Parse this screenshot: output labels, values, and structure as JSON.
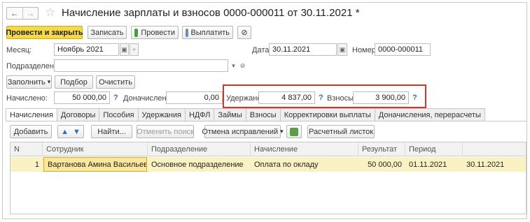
{
  "window": {
    "title": "Начисление зарплаты и взносов 0000-000011 от 30.11.2021 *",
    "nav_back": "←",
    "nav_forward": "→",
    "star_icon": "☆"
  },
  "toolbar": {
    "post_close": "Провести и закрыть",
    "save": "Записать",
    "post": "Провести",
    "pay": "Выплатить",
    "attach_icon": "⊘"
  },
  "header": {
    "month_label": "Месяц:",
    "month_value": "Ноябрь 2021",
    "date_label": "Дата:",
    "date_value": "30.11.2021",
    "number_label": "Номер:",
    "number_value": "0000-000011",
    "department_label": "Подразделение:",
    "department_value": ""
  },
  "actions": {
    "fill": "Заполнить",
    "select": "Подбор",
    "clear": "Очистить"
  },
  "totals": {
    "accrued_label": "Начислено:",
    "accrued_value": "50 000,00",
    "additional_label": "Доначислено:",
    "additional_value": "0,00",
    "withheld_label": "Удержано:",
    "withheld_value": "4 837,00",
    "contrib_label": "Взносы:",
    "contrib_value": "3 900,00",
    "help": "?"
  },
  "tabs": [
    "Начисления",
    "Договоры",
    "Пособия",
    "Удержания",
    "НДФЛ",
    "Займы",
    "Взносы",
    "Корректировки выплаты",
    "Доначисления, перерасчеты"
  ],
  "table_toolbar": {
    "add": "Добавить",
    "find": "Найти...",
    "cancel_search": "Отменить поиск",
    "cancel_corrections": "Отмена исправлений",
    "payslip": "Расчетный листок"
  },
  "table": {
    "columns": [
      "N",
      "Сотрудник",
      "Подразделение",
      "Начисление",
      "Результат",
      "Период",
      ""
    ],
    "rows": [
      [
        "1",
        "Вартанова Амина Васильевна",
        "Основное подразделение",
        "Оплата по окладу",
        "50 000,00",
        "01.11.2021",
        "30.11.2021"
      ]
    ]
  },
  "colors": {
    "primary_button": "#f5d94a",
    "highlight_box": "#e0302a",
    "selected_row": "#fbf2c4",
    "help_mark": "#2b6fc4"
  }
}
